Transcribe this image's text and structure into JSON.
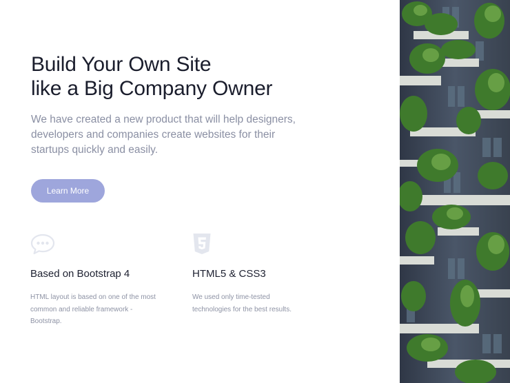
{
  "hero": {
    "headline_line1": "Build Your Own Site",
    "headline_line2": "like a Big Company Owner",
    "lead": "We have created a new product that will help designers, developers and companies create websites for their startups quickly and easily.",
    "cta_label": "Learn More"
  },
  "features": [
    {
      "icon": "chat-bubble-icon",
      "title": "Based on Bootstrap 4",
      "description": "HTML layout is based on one of the most common and reliable framework - Bootstrap."
    },
    {
      "icon": "html5-shield-icon",
      "title": "HTML5 & CSS3",
      "description": "We used only time-tested technologies for the best results."
    }
  ],
  "photo": {
    "subject": "building-with-vertical-garden-balconies"
  },
  "colors": {
    "accent_button": "#9ea6dc",
    "heading": "#1a1d2c",
    "muted_text": "#8a8fa3",
    "icon_tint": "#e3e6ee"
  }
}
